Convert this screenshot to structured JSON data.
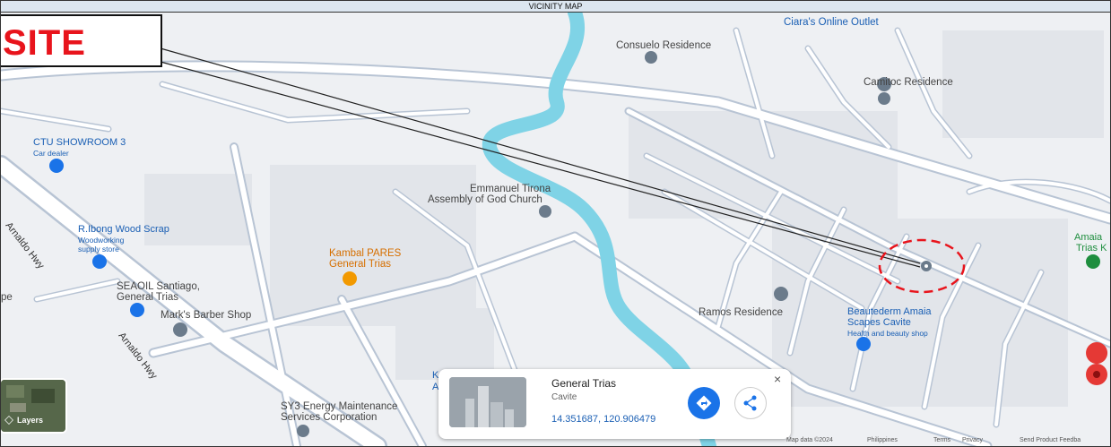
{
  "title": "VICINITY MAP",
  "site_label": "SITE",
  "places": {
    "claras": "Ciara's Online Outlet",
    "consuelo": "Consuelo Residence",
    "camitoc": "Camitoc Residence",
    "ctu": "CTU SHOWROOM 3",
    "ctu_sub": "Car dealer",
    "emmanuel_1": "Emmanuel Tirona",
    "emmanuel_2": "Assembly of God Church",
    "ribong": "R.Ibong Wood Scrap",
    "ribong_sub1": "Woodworking",
    "ribong_sub2": "supply store",
    "kambal_1": "Kambal PARES",
    "kambal_2": "General Trias",
    "seaoil_1": "SEAOIL Santiago,",
    "seaoil_2": "General Trias",
    "marks": "Mark's Barber Shop",
    "ramos": "Ramos Residence",
    "beaute_1": "Beautederm Amaia",
    "beaute_2": "Scapes Cavite",
    "beaute_sub": "Health and beauty shop",
    "amaia_1": "Amaia",
    "amaia_2": "Trias K",
    "sy3_1": "SY3 Energy Maintenance",
    "sy3_2": "Services Corporation",
    "left_edge": "pe",
    "k_partial": "K",
    "a_partial": "A"
  },
  "roads": {
    "road1": "Arnaldo Hwy",
    "road2": "Arnaldo Hwy"
  },
  "card": {
    "title": "General Trias",
    "subtitle": "Cavite",
    "coords": "14.351687, 120.906479",
    "close": "×"
  },
  "layers_label": "Layers",
  "footer": {
    "map_data": "Map data ©2024",
    "country": "Philippines",
    "terms": "Terms",
    "privacy": "Privacy",
    "feedback": "Send Product Feedba"
  },
  "colors": {
    "river": "#7fd3e6",
    "road": "#ffffff",
    "road_edge": "#b8c4d4",
    "site_red": "#e8141c",
    "marker_red": "#e53935",
    "pin_gray": "#6b7b8b"
  },
  "icons": {
    "pin": "map-pin-icon",
    "directions": "directions-icon",
    "share": "share-icon",
    "close": "close-icon",
    "layers": "layers-icon"
  }
}
